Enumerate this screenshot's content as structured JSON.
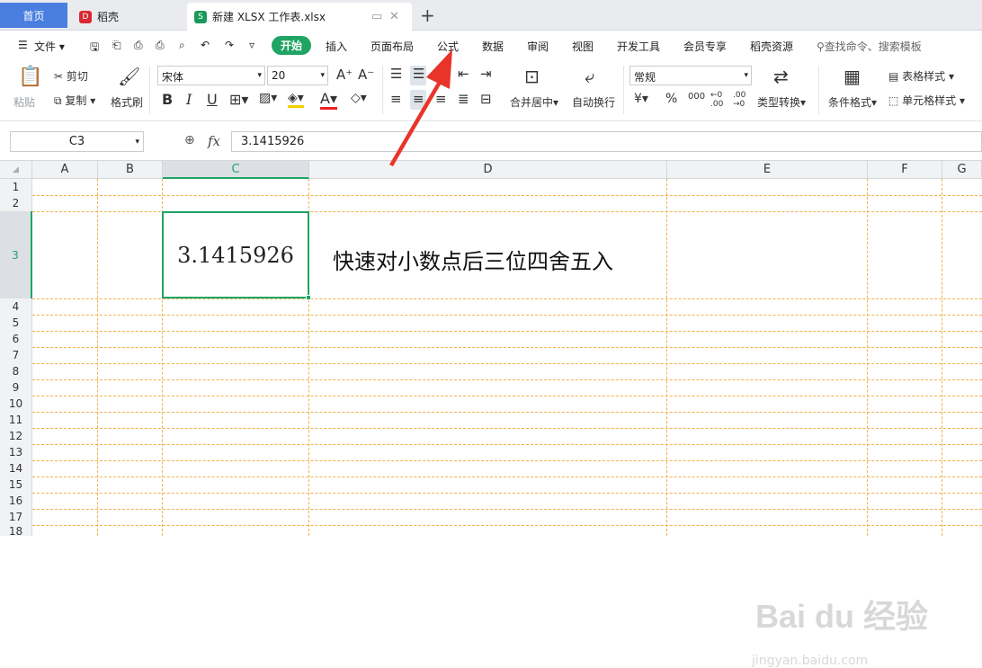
{
  "tabs": {
    "home": "首页",
    "daoke": "稻壳",
    "file": "新建 XLSX 工作表.xlsx"
  },
  "menu": {
    "file": "文件",
    "start": "开始",
    "items": [
      "插入",
      "页面布局",
      "公式",
      "数据",
      "审阅",
      "视图",
      "开发工具",
      "会员专享",
      "稻壳资源"
    ],
    "search": "查找命令、搜索模板"
  },
  "ribbon": {
    "paste": "粘贴",
    "cut": "剪切",
    "copy": "复制",
    "format_painter": "格式刷",
    "font": "宋体",
    "size": "20",
    "merge": "合并居中",
    "wrap": "自动换行",
    "numfmt": "常规",
    "convert": "类型转换",
    "cond": "条件格式",
    "tablestyle": "表格样式",
    "cellstyle": "单元格样式"
  },
  "formula_bar": {
    "name": "C3",
    "fx": "fx",
    "value": "3.1415926"
  },
  "columns": [
    "A",
    "B",
    "C",
    "D",
    "E",
    "F",
    "G"
  ],
  "rows": [
    "1",
    "2",
    "3",
    "4",
    "5",
    "6",
    "7",
    "8",
    "9",
    "10",
    "11",
    "12",
    "13",
    "14",
    "15",
    "16",
    "17",
    "18"
  ],
  "cells": {
    "C3": "3.1415926",
    "D3": "快速对小数点后三位四舍五入"
  },
  "watermark": {
    "logo": "Bai du 经验",
    "url": "jingyan.baidu.com"
  },
  "colors": {
    "accent": "#1fa463",
    "home_tab": "#4a7fe0",
    "grid_line": "#f0b24e",
    "arrow": "#e8342a"
  }
}
